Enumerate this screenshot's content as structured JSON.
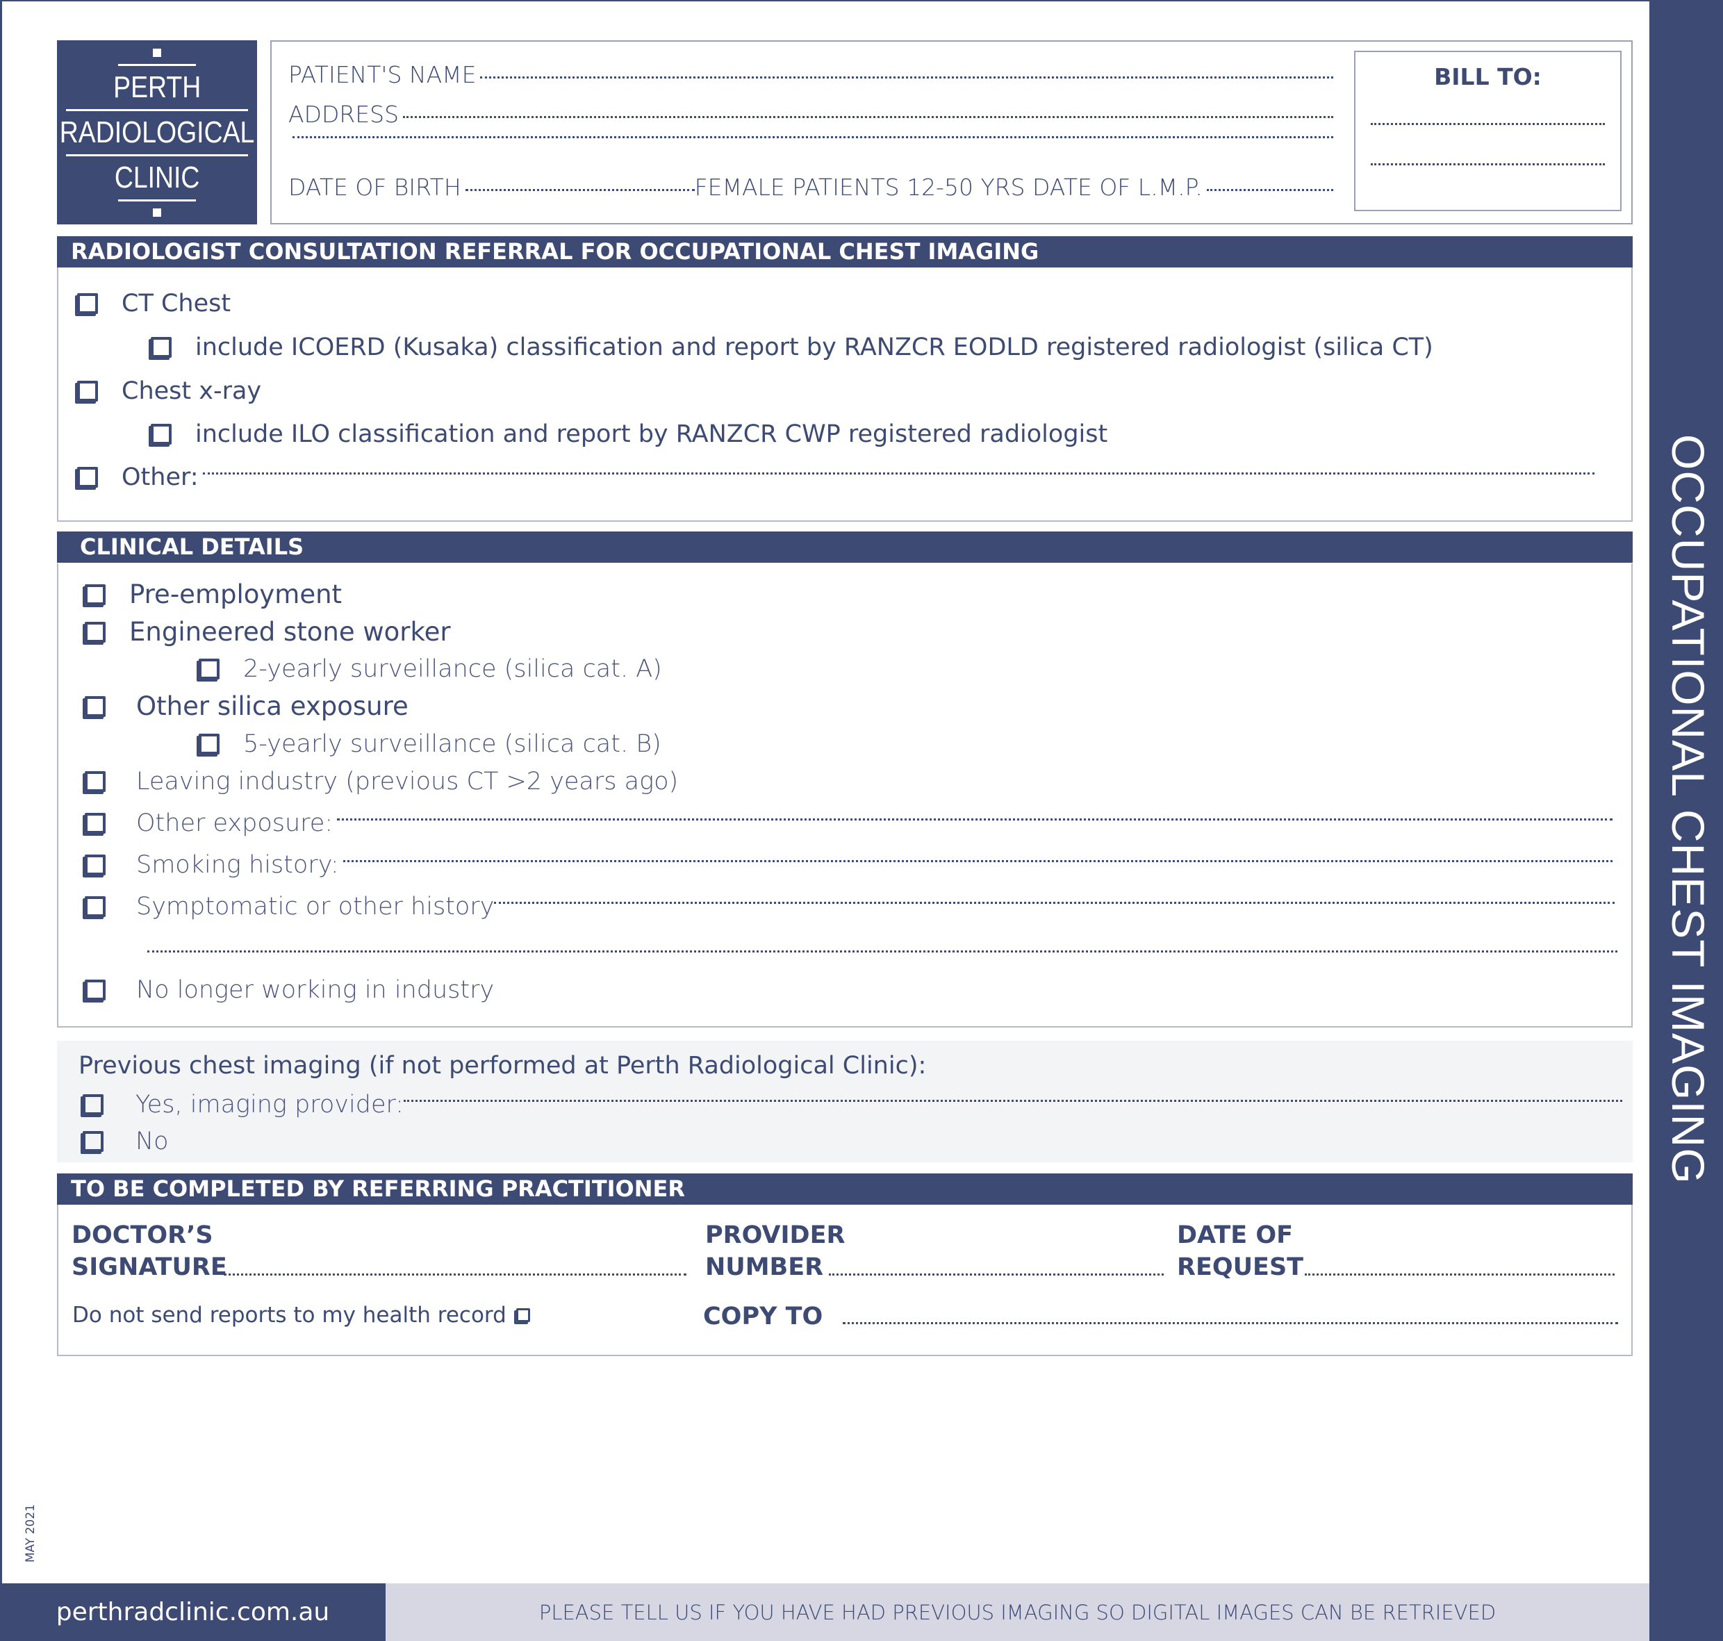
{
  "colors": {
    "brand": "#3d4a73",
    "footer_gray": "#d6d7e2"
  },
  "logo": {
    "line1": "PERTH",
    "line2": "RADIOLOGICAL",
    "line3": "CLINIC"
  },
  "patient": {
    "name_label": "PATIENT'S NAME",
    "address_label": "ADDRESS",
    "dob_label": "DATE OF BIRTH",
    "lmp_label": "FEMALE PATIENTS 12-50 YRS DATE OF L.M.P."
  },
  "bill_to": {
    "label": "BILL TO:"
  },
  "side_title": "OCCUPATIONAL CHEST IMAGING",
  "referral": {
    "title": "RADIOLOGIST CONSULTATION REFERRAL FOR OCCUPATIONAL CHEST IMAGING",
    "items": [
      "CT Chest",
      "include ICOERD (Kusaka) classification and report by RANZCR EODLD registered radiologist (silica CT)",
      "Chest x-ray",
      "include  ILO classification and report by RANZCR CWP registered radiologist",
      "Other:"
    ]
  },
  "clinical": {
    "title": "CLINICAL DETAILS",
    "items": [
      "Pre-employment",
      "Engineered stone worker",
      "2-yearly surveillance (silica cat. A)",
      "Other silica exposure",
      "5-yearly surveillance (silica cat. B)",
      "Leaving industry (previous CT >2 years ago)",
      "Other exposure:",
      "Smoking history:",
      "Symptomatic or other history",
      "No longer working in industry"
    ]
  },
  "previous": {
    "title": "Previous chest imaging (if not performed at Perth Radiological Clinic):",
    "yes": "Yes, imaging provider:",
    "no": "No"
  },
  "practitioner": {
    "title": "TO BE COMPLETED BY REFERRING PRACTITIONER",
    "sig1": "DOCTOR’S",
    "sig2": "SIGNATURE",
    "prov1": "PROVIDER",
    "prov2": "NUMBER",
    "date1": "DATE OF",
    "date2": "REQUEST",
    "no_record": "Do not send reports to my health record",
    "copy_to": "COPY TO"
  },
  "edition": "MAY 2021",
  "footer": {
    "website": "perthradclinic.com.au",
    "notice": "PLEASE TELL US IF YOU HAVE HAD PREVIOUS IMAGING SO DIGITAL IMAGES CAN BE RETRIEVED"
  }
}
